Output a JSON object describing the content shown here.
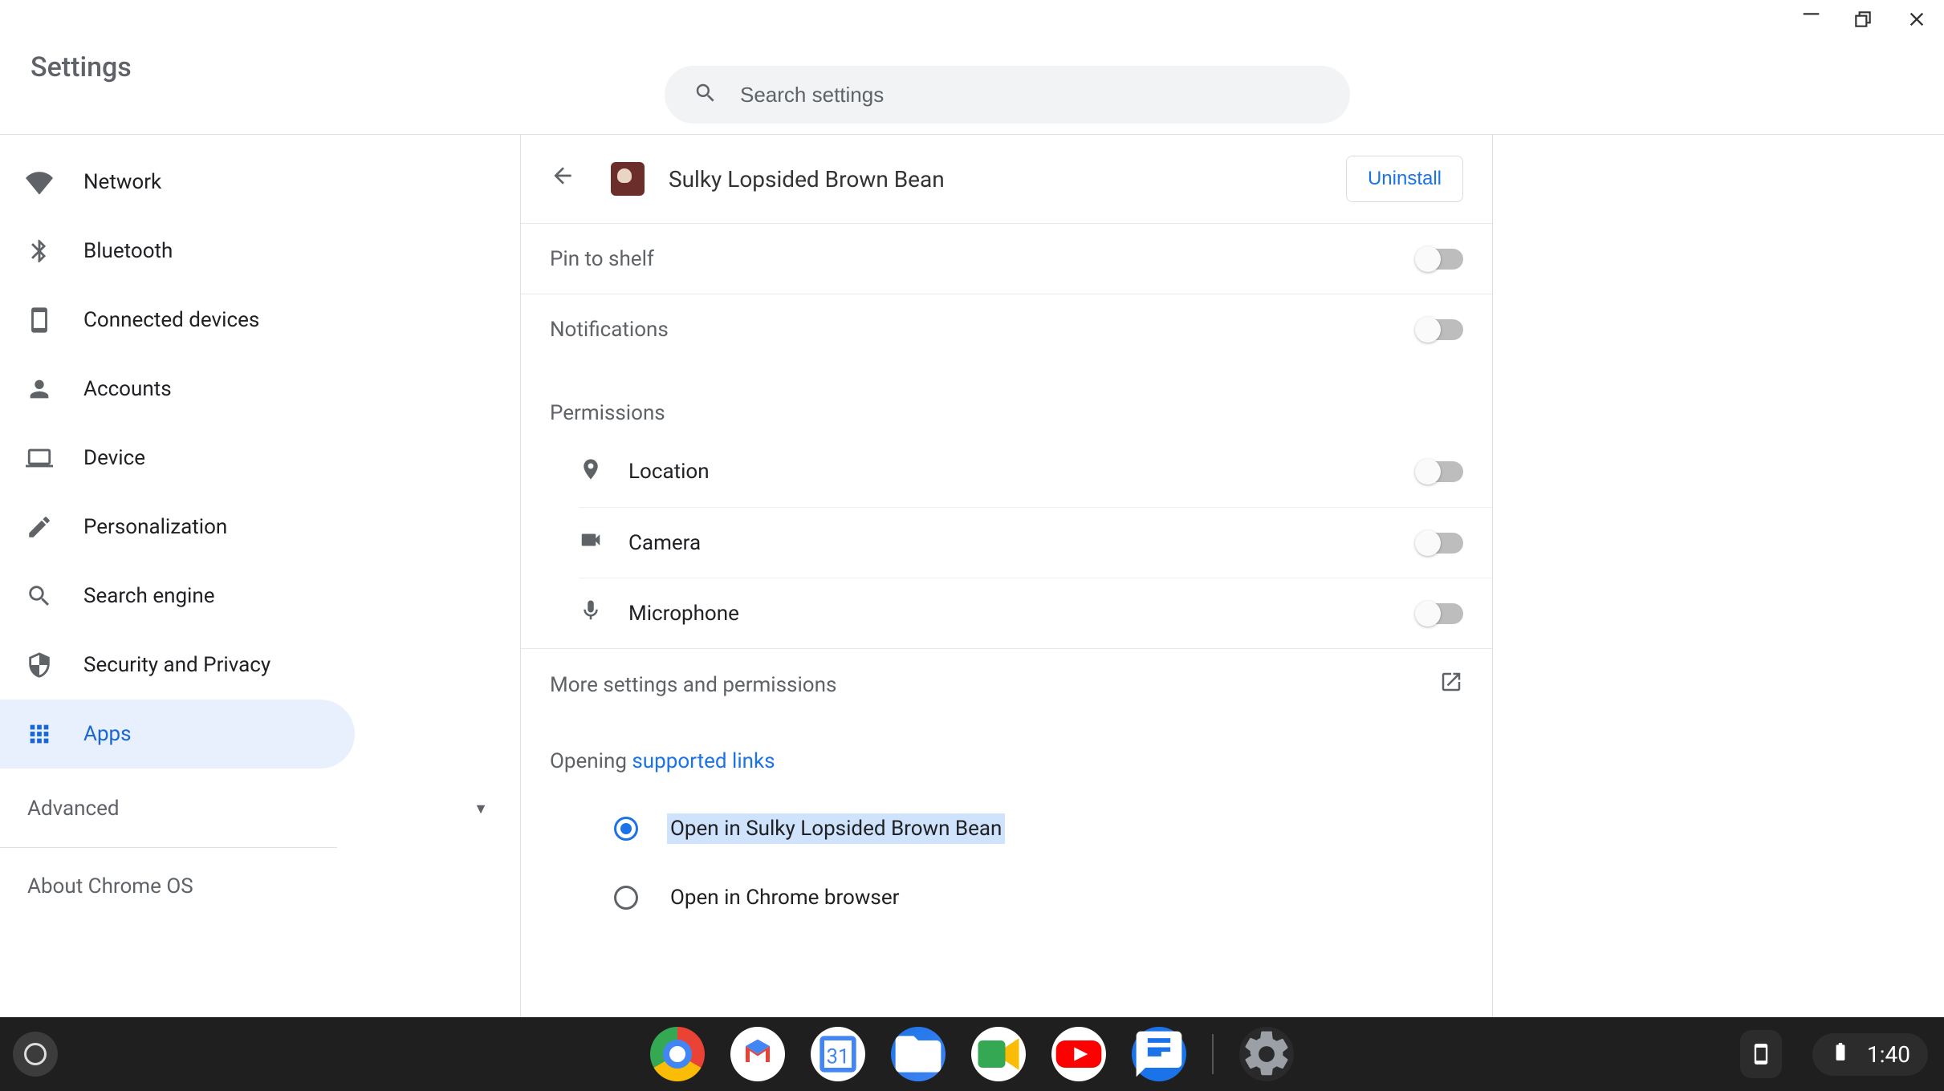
{
  "window": {
    "title": "Settings"
  },
  "search": {
    "placeholder": "Search settings"
  },
  "sidebar": {
    "items": [
      {
        "label": "Network"
      },
      {
        "label": "Bluetooth"
      },
      {
        "label": "Connected devices"
      },
      {
        "label": "Accounts"
      },
      {
        "label": "Device"
      },
      {
        "label": "Personalization"
      },
      {
        "label": "Search engine"
      },
      {
        "label": "Security and Privacy"
      },
      {
        "label": "Apps"
      }
    ],
    "advanced": "Advanced",
    "about": "About Chrome OS"
  },
  "page": {
    "app_name": "Sulky Lopsided Brown Bean",
    "uninstall": "Uninstall",
    "pin_to_shelf": "Pin to shelf",
    "notifications": "Notifications",
    "permissions_label": "Permissions",
    "permissions": {
      "location": "Location",
      "camera": "Camera",
      "microphone": "Microphone"
    },
    "more_settings": "More settings and permissions",
    "opening_prefix": "Opening ",
    "supported_links": "supported links",
    "open_in_app": "Open in Sulky Lopsided Brown Bean",
    "open_in_browser": "Open in Chrome browser"
  },
  "shelf": {
    "time": "1:40"
  }
}
